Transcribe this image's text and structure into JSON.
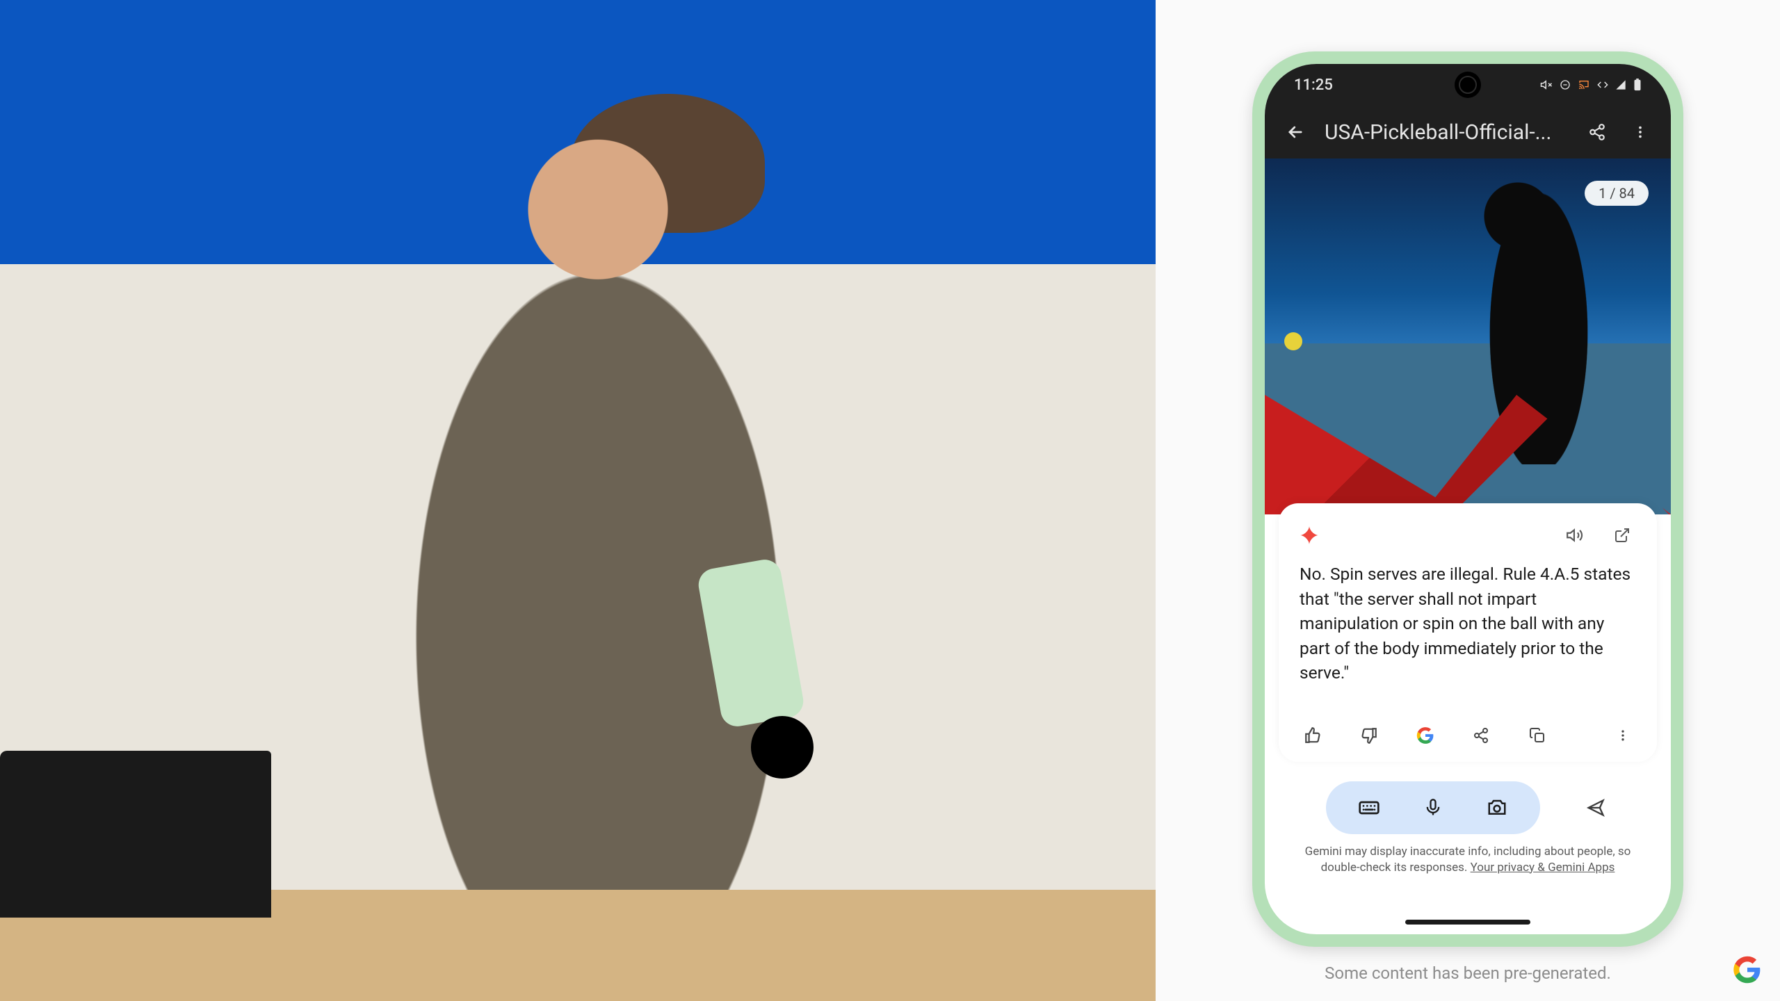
{
  "status_bar": {
    "time": "11:25"
  },
  "app_bar": {
    "title": "USA-Pickleball-Official-..."
  },
  "document": {
    "page_indicator": "1 / 84"
  },
  "gemini_response": {
    "text": "No. Spin serves are illegal. Rule 4.A.5 states that \"the server shall not impart manipulation or spin on the ball with any part of the body immediately prior to the serve.\""
  },
  "disclaimer": {
    "text_prefix": "Gemini may display inaccurate info, including about people, so double-check its responses. ",
    "link_text": "Your privacy & Gemini Apps"
  },
  "caption": "Some content has been pre-generated."
}
